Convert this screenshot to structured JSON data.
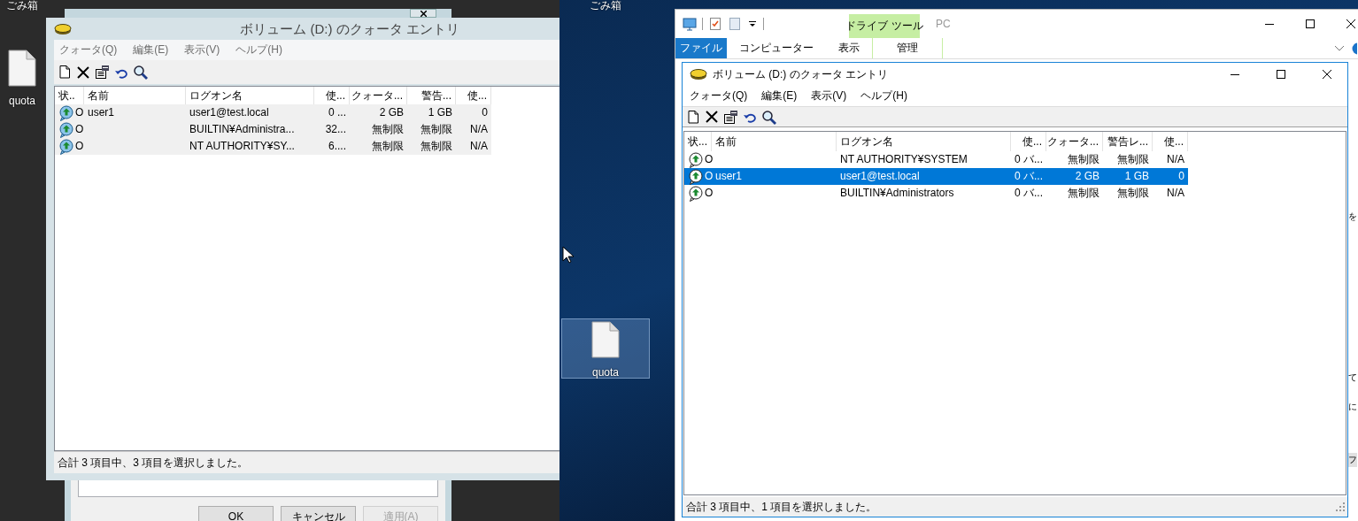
{
  "left_screen": {
    "desktop_icons": [
      {
        "label": "ごみ箱",
        "kind": "recycle_bin",
        "selected": false
      },
      {
        "label": "quota",
        "kind": "file",
        "selected": false
      }
    ],
    "dialog": {
      "buttons": [
        {
          "label": "OK",
          "disabled": false
        },
        {
          "label": "キャンセル",
          "disabled": false
        },
        {
          "label": "適用(A)",
          "disabled": true
        }
      ]
    },
    "quota_window": {
      "title": "ボリューム (D:) のクォータ エントリ",
      "active": false,
      "menus": [
        "クォータ(Q)",
        "編集(E)",
        "表示(V)",
        "ヘルプ(H)"
      ],
      "columns": [
        "状..",
        "名前",
        "ログオン名",
        "使...",
        "クォータ...",
        "警告...",
        "使..."
      ],
      "rows": [
        {
          "status": "O",
          "name": "user1",
          "logon_name": "user1@test.local",
          "used": "0 ...",
          "quota_limit": "2 GB",
          "warning_level": "1 GB",
          "percent_used": "0",
          "selected": true
        },
        {
          "status": "O",
          "logon_name": "BUILTIN¥Administra...",
          "used": "32...",
          "quota_limit": "無制限",
          "warning_level": "無制限",
          "percent_used": "N/A",
          "selected": true
        },
        {
          "status": "O",
          "logon_name": "NT AUTHORITY¥SY...",
          "used": "6....",
          "quota_limit": "無制限",
          "warning_level": "無制限",
          "percent_used": "N/A",
          "selected": true
        }
      ],
      "status_bar": "合計 3 項目中、3 項目を選択しました。"
    }
  },
  "right_screen": {
    "desktop_icons": [
      {
        "label": "ごみ箱",
        "kind": "recycle_bin",
        "selected": false
      },
      {
        "label": "quota",
        "kind": "file",
        "selected": true
      }
    ],
    "explorer": {
      "context_tab_group": "ドライブ ツール",
      "title": "PC",
      "ribbon_tabs": [
        {
          "label": "ファイル",
          "kind": "file"
        },
        {
          "label": "コンピューター",
          "kind": "tab"
        },
        {
          "label": "表示",
          "kind": "tab"
        },
        {
          "label": "管理",
          "kind": "context"
        }
      ],
      "side_text": [
        "を",
        "て",
        "に",
        "フ"
      ]
    },
    "quota_window": {
      "title": "ボリューム (D:) のクォータ エントリ",
      "active": true,
      "menus": [
        "クォータ(Q)",
        "編集(E)",
        "表示(V)",
        "ヘルプ(H)"
      ],
      "columns": [
        "状...",
        "名前",
        "ログオン名",
        "使...",
        "クォータ...",
        "警告レ...",
        "使..."
      ],
      "rows": [
        {
          "status": "O",
          "logon_name": "NT AUTHORITY¥SYSTEM",
          "used": "0 バ...",
          "quota_limit": "無制限",
          "warning_level": "無制限",
          "percent_used": "N/A",
          "selected": false
        },
        {
          "status": "O",
          "name": "user1",
          "logon_name": "user1@test.local",
          "used": "0 バ...",
          "quota_limit": "2 GB",
          "warning_level": "1 GB",
          "percent_used": "0",
          "selected": true
        },
        {
          "status": "O",
          "logon_name": "BUILTIN¥Administrators",
          "used": "0 バ...",
          "quota_limit": "無制限",
          "warning_level": "無制限",
          "percent_used": "N/A",
          "selected": false
        }
      ],
      "status_bar": "合計 3 項目中、1 項目を選択しました。"
    }
  }
}
